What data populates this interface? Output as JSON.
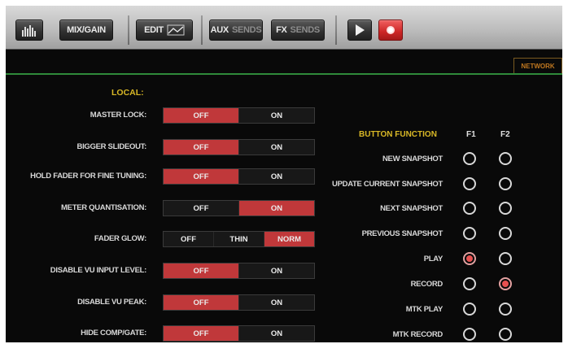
{
  "toolbar": {
    "mix_gain": "MIX/GAIN",
    "edit": "EDIT",
    "aux": "AUX",
    "aux_dim": "SENDS",
    "fx": "FX",
    "fx_dim": "SENDS"
  },
  "network_tab": "NETWORK",
  "local_heading": "LOCAL:",
  "settings": [
    {
      "label": "MASTER LOCK:",
      "options": [
        "OFF",
        "ON"
      ],
      "selected": 0
    },
    {
      "label": "BIGGER SLIDEOUT:",
      "options": [
        "OFF",
        "ON"
      ],
      "selected": 0
    },
    {
      "label": "HOLD FADER FOR FINE TUNING:",
      "options": [
        "OFF",
        "ON"
      ],
      "selected": 0
    },
    {
      "label": "METER QUANTISATION:",
      "options": [
        "OFF",
        "ON"
      ],
      "selected": 1
    },
    {
      "label": "FADER GLOW:",
      "options": [
        "OFF",
        "THIN",
        "NORM"
      ],
      "selected": 2
    },
    {
      "label": "DISABLE VU INPUT LEVEL:",
      "options": [
        "OFF",
        "ON"
      ],
      "selected": 0
    },
    {
      "label": "DISABLE VU PEAK:",
      "options": [
        "OFF",
        "ON"
      ],
      "selected": 0
    },
    {
      "label": "HIDE COMP/GATE:",
      "options": [
        "OFF",
        "ON"
      ],
      "selected": 0
    }
  ],
  "button_function": {
    "heading": "BUTTON FUNCTION",
    "f1": "F1",
    "f2": "F2",
    "rows": [
      {
        "label": "NEW SNAPSHOT",
        "f1": false,
        "f2": false
      },
      {
        "label": "UPDATE CURRENT SNAPSHOT",
        "f1": false,
        "f2": false
      },
      {
        "label": "NEXT SNAPSHOT",
        "f1": false,
        "f2": false
      },
      {
        "label": "PREVIOUS SNAPSHOT",
        "f1": false,
        "f2": false
      },
      {
        "label": "PLAY",
        "f1": true,
        "f2": false
      },
      {
        "label": "RECORD",
        "f1": false,
        "f2": true
      },
      {
        "label": "MTK PLAY",
        "f1": false,
        "f2": false
      },
      {
        "label": "MTK RECORD",
        "f1": false,
        "f2": false
      }
    ]
  },
  "colors": {
    "accent_red": "#c0383a",
    "heading_yellow": "#d9b826",
    "divider_green": "#2f8a3a",
    "network_orange": "#c07820"
  }
}
